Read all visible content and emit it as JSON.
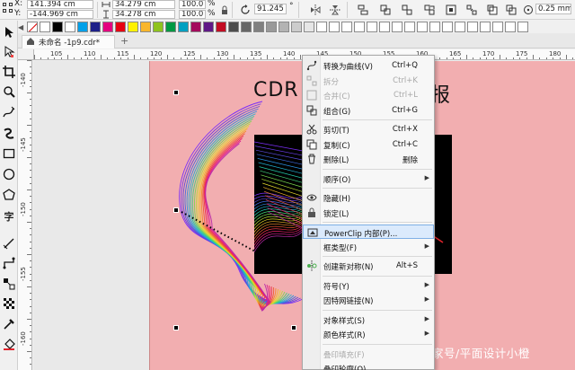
{
  "property_bar": {
    "x_label": "X:",
    "x_value": "141.394 cm",
    "y_label": "Y:",
    "y_value": "-144.969 cm",
    "width_value": "34.279 cm",
    "height_value": "34.278 cm",
    "scale_x": "100.0",
    "scale_y": "100.0",
    "percent": "%",
    "rotation": "91.245",
    "outline_width": "0.25 mm"
  },
  "palette": {
    "colors": [
      "#ffffff",
      "#000000",
      "#ffffff",
      "#00a0e9",
      "#1d2088",
      "#e4007f",
      "#e60012",
      "#fff100",
      "#f8b62d",
      "#8fc31f",
      "#009944",
      "#00a0c1",
      "#a40b5d",
      "#601986",
      "#c30d23",
      "#4d4d4d",
      "#666666",
      "#808080",
      "#999999",
      "#b3b3b3",
      "#cccccc",
      "#e6e6e6",
      "#ffffff",
      "#ffffff",
      "#ffffff",
      "#ffffff",
      "#ffffff",
      "#ffffff",
      "#ffffff",
      "#ffffff",
      "#ffffff",
      "#ffffff",
      "#ffffff",
      "#ffffff",
      "#ffffff",
      "#ffffff",
      "#ffffff",
      "#ffffff",
      "#ffffff"
    ]
  },
  "tab": {
    "label": "未命名 -1p9.cdr*",
    "add": "+"
  },
  "rulers": {
    "h_numbers": [
      "105",
      "110",
      "115",
      "120",
      "125",
      "130",
      "135",
      "140",
      "145",
      "150",
      "155",
      "160",
      "165",
      "170",
      "175",
      "180"
    ],
    "v_numbers": [
      "-140",
      "-145",
      "-150",
      "-155",
      "-160"
    ]
  },
  "canvas": {
    "title_left": "CDR",
    "title_right": "报",
    "watermark": "家号/平面设计小橙"
  },
  "context_menu": {
    "items": [
      {
        "label": "转换为曲线(V)",
        "shortcut": "Ctrl+Q",
        "disabled": false,
        "submenu": false,
        "icon": "convert-curve-icon"
      },
      {
        "label": "拆分",
        "shortcut": "Ctrl+K",
        "disabled": true,
        "submenu": false,
        "icon": "break-apart-icon"
      },
      {
        "label": "合并(C)",
        "shortcut": "Ctrl+L",
        "disabled": true,
        "submenu": false,
        "icon": "combine-icon"
      },
      {
        "label": "组合(G)",
        "shortcut": "Ctrl+G",
        "disabled": false,
        "submenu": false,
        "icon": "group-icon"
      },
      {
        "label": "剪切(T)",
        "shortcut": "Ctrl+X",
        "disabled": false,
        "submenu": false,
        "icon": "cut-icon"
      },
      {
        "label": "复制(C)",
        "shortcut": "Ctrl+C",
        "disabled": false,
        "submenu": false,
        "icon": "copy-icon"
      },
      {
        "label": "删除(L)",
        "shortcut": "删除",
        "disabled": false,
        "submenu": false,
        "icon": "delete-icon"
      },
      {
        "label": "顺序(O)",
        "shortcut": "",
        "disabled": false,
        "submenu": true,
        "icon": ""
      },
      {
        "label": "隐藏(H)",
        "shortcut": "",
        "disabled": false,
        "submenu": false,
        "icon": "eye-icon"
      },
      {
        "label": "锁定(L)",
        "shortcut": "",
        "disabled": false,
        "submenu": false,
        "icon": "lock-icon"
      },
      {
        "label": "PowerClip 内部(P)...",
        "shortcut": "",
        "disabled": false,
        "submenu": false,
        "icon": "powerclip-icon",
        "highlighted": true
      },
      {
        "label": "框类型(F)",
        "shortcut": "",
        "disabled": false,
        "submenu": true,
        "icon": ""
      },
      {
        "label": "创建新对称(N)",
        "shortcut": "Alt+S",
        "disabled": false,
        "submenu": false,
        "icon": "symmetry-icon"
      },
      {
        "label": "符号(Y)",
        "shortcut": "",
        "disabled": false,
        "submenu": true,
        "icon": ""
      },
      {
        "label": "因特网链接(N)",
        "shortcut": "",
        "disabled": false,
        "submenu": true,
        "icon": ""
      },
      {
        "label": "对象样式(S)",
        "shortcut": "",
        "disabled": false,
        "submenu": true,
        "icon": ""
      },
      {
        "label": "颜色样式(R)",
        "shortcut": "",
        "disabled": false,
        "submenu": true,
        "icon": ""
      },
      {
        "label": "叠印填充(F)",
        "shortcut": "",
        "disabled": true,
        "submenu": false,
        "icon": ""
      },
      {
        "label": "叠印轮廓(O)",
        "shortcut": "",
        "disabled": false,
        "submenu": false,
        "icon": ""
      }
    ],
    "submenu_arrow": "▶"
  }
}
